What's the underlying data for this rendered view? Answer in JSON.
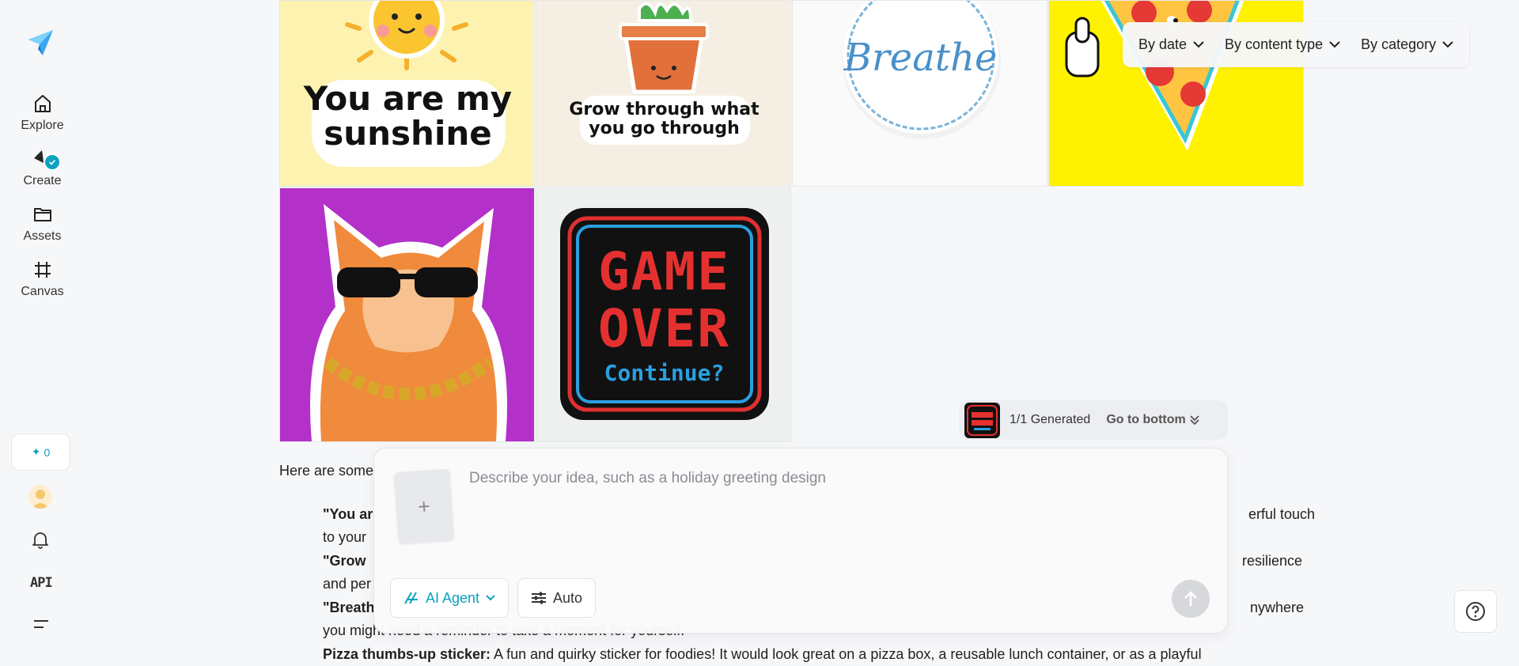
{
  "sidebar": {
    "items": [
      {
        "label": "Explore",
        "icon": "home-icon"
      },
      {
        "label": "Create",
        "icon": "create-icon"
      },
      {
        "label": "Assets",
        "icon": "folder-icon"
      },
      {
        "label": "Canvas",
        "icon": "canvas-icon"
      }
    ],
    "credits": "0",
    "api_label": "API"
  },
  "filters": {
    "by_date": "By date",
    "by_content_type": "By content type",
    "by_category": "By category"
  },
  "gallery": {
    "tiles": [
      {
        "text_line1": "You are my",
        "text_line2": "sunshine"
      },
      {
        "text_line1": "Grow through what",
        "text_line2": "you go through"
      },
      {
        "text": "Breathe"
      },
      {
        "text": ""
      },
      {
        "text": ""
      },
      {
        "text_line1": "GAME",
        "text_line2": "OVER",
        "text_line3": "Continue?"
      }
    ]
  },
  "generated": {
    "count": "1/1",
    "label": "Generated",
    "goto": "Go to bottom"
  },
  "content": {
    "intro": "Here are some",
    "b1_bold": "\"You ar",
    "b1_tail": "erful touch",
    "b1_line2": "to your",
    "b2_bold": "\"Grow ",
    "b2_tail": "resilience",
    "b2_line2": "and per",
    "b3_bold": "\"Breath",
    "b3_tail": "nywhere",
    "b3_line2": "you might need a reminder to take a moment for yourself.",
    "b4_bold": "Pizza thumbs-up sticker:",
    "b4_rest": " A fun and quirky sticker for foodies! It would look great on a pizza box, a reusable lunch container, or as a playful"
  },
  "prompt": {
    "placeholder": "Describe your idea, such as a holiday greeting design",
    "add_label": "+",
    "agent_label": "AI Agent",
    "auto_label": "Auto"
  },
  "colors": {
    "accent": "#0aa2c0",
    "sidebar_bg": "#f6f7f9"
  }
}
